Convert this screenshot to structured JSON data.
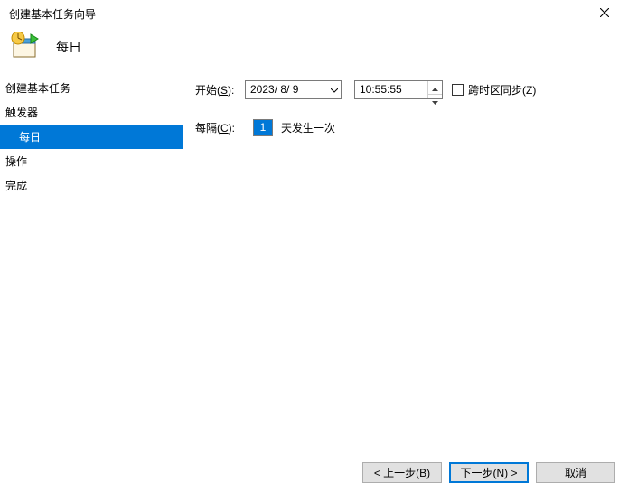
{
  "window": {
    "title": "创建基本任务向导"
  },
  "header": {
    "page_title": "每日"
  },
  "sidebar": {
    "items": [
      {
        "label": "创建基本任务",
        "sub": false
      },
      {
        "label": "触发器",
        "sub": false
      },
      {
        "label": "每日",
        "sub": true
      },
      {
        "label": "操作",
        "sub": false
      },
      {
        "label": "完成",
        "sub": false
      }
    ],
    "selected_index": 2
  },
  "form": {
    "start_label_pre": "开始(",
    "start_label_key": "S",
    "start_label_post": "):",
    "date_value": "2023/ 8/ 9",
    "time_value": "10:55:55",
    "tz_label_pre": "跨时区同步(",
    "tz_label_key": "Z",
    "tz_label_post": ")",
    "interval_label_pre": "每隔(",
    "interval_label_key": "C",
    "interval_label_post": "):",
    "interval_value": "1",
    "interval_suffix": "天发生一次"
  },
  "footer": {
    "back_pre": "< 上一步(",
    "back_key": "B",
    "back_post": ")",
    "next_pre": "下一步(",
    "next_key": "N",
    "next_post": ") >",
    "cancel": "取消"
  }
}
